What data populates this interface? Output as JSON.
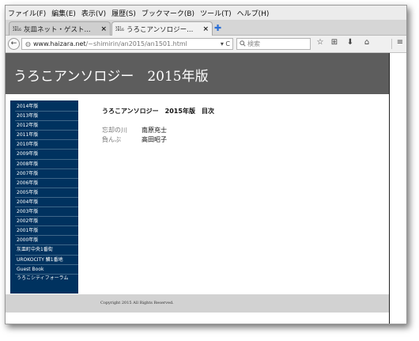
{
  "menu": [
    "ファイル(F)",
    "編集(E)",
    "表示(V)",
    "履歴(S)",
    "ブックマーク(B)",
    "ツール(T)",
    "ヘルプ(H)"
  ],
  "tabs": [
    {
      "favicon": "ver 2016",
      "title": "灰皿ネット・ゲスト...",
      "close": "×",
      "active": false
    },
    {
      "favicon": "ver 2016",
      "title": "うろこアンソロジー...",
      "close": "×",
      "active": true
    }
  ],
  "new_tab": "✚",
  "nav": {
    "back": "←",
    "url_host": "www.haizara.net",
    "url_path": "/~shimirin/an2015/an1501.html",
    "dropdown": "▾",
    "reload": "C",
    "search_placeholder": "検索",
    "search_icon": "search-icon",
    "bookmark_star": "☆",
    "reading_list": "⊞",
    "download": "⬇",
    "home": "⌂",
    "menu": "≡"
  },
  "page": {
    "banner_title": "うろこアンソロジー　2015年版",
    "sidebar": [
      "2014年版",
      "2013年版",
      "2012年版",
      "2011年版",
      "2010年版",
      "2009年版",
      "2008年版",
      "2007年版",
      "2006年版",
      "2005年版",
      "2004年版",
      "2003年版",
      "2002年版",
      "2001年版",
      "2000年版",
      "灰皿町中央1番街",
      "UROKOCITY 鱗1番地",
      "Guest Book",
      "うろこシティフォーラム"
    ],
    "toc_title": "うろこアンソロジー　2015年版　目次",
    "toc": [
      {
        "work": "忘却の川",
        "author": "南原充士"
      },
      {
        "work": "負んぶ",
        "author": "高田昭子"
      }
    ],
    "footer": "Copyright 2015 All Rights Reserved."
  }
}
